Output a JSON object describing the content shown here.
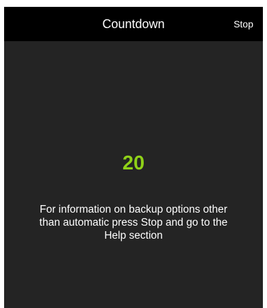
{
  "header": {
    "title": "Countdown",
    "stop_label": "Stop"
  },
  "countdown": {
    "value": "20",
    "color": "#8fd118"
  },
  "message": {
    "text": "For information on backup options other than automatic press Stop and go to the Help section"
  },
  "colors": {
    "navbar": "#000000",
    "background": "#242424",
    "text": "#ffffff"
  }
}
